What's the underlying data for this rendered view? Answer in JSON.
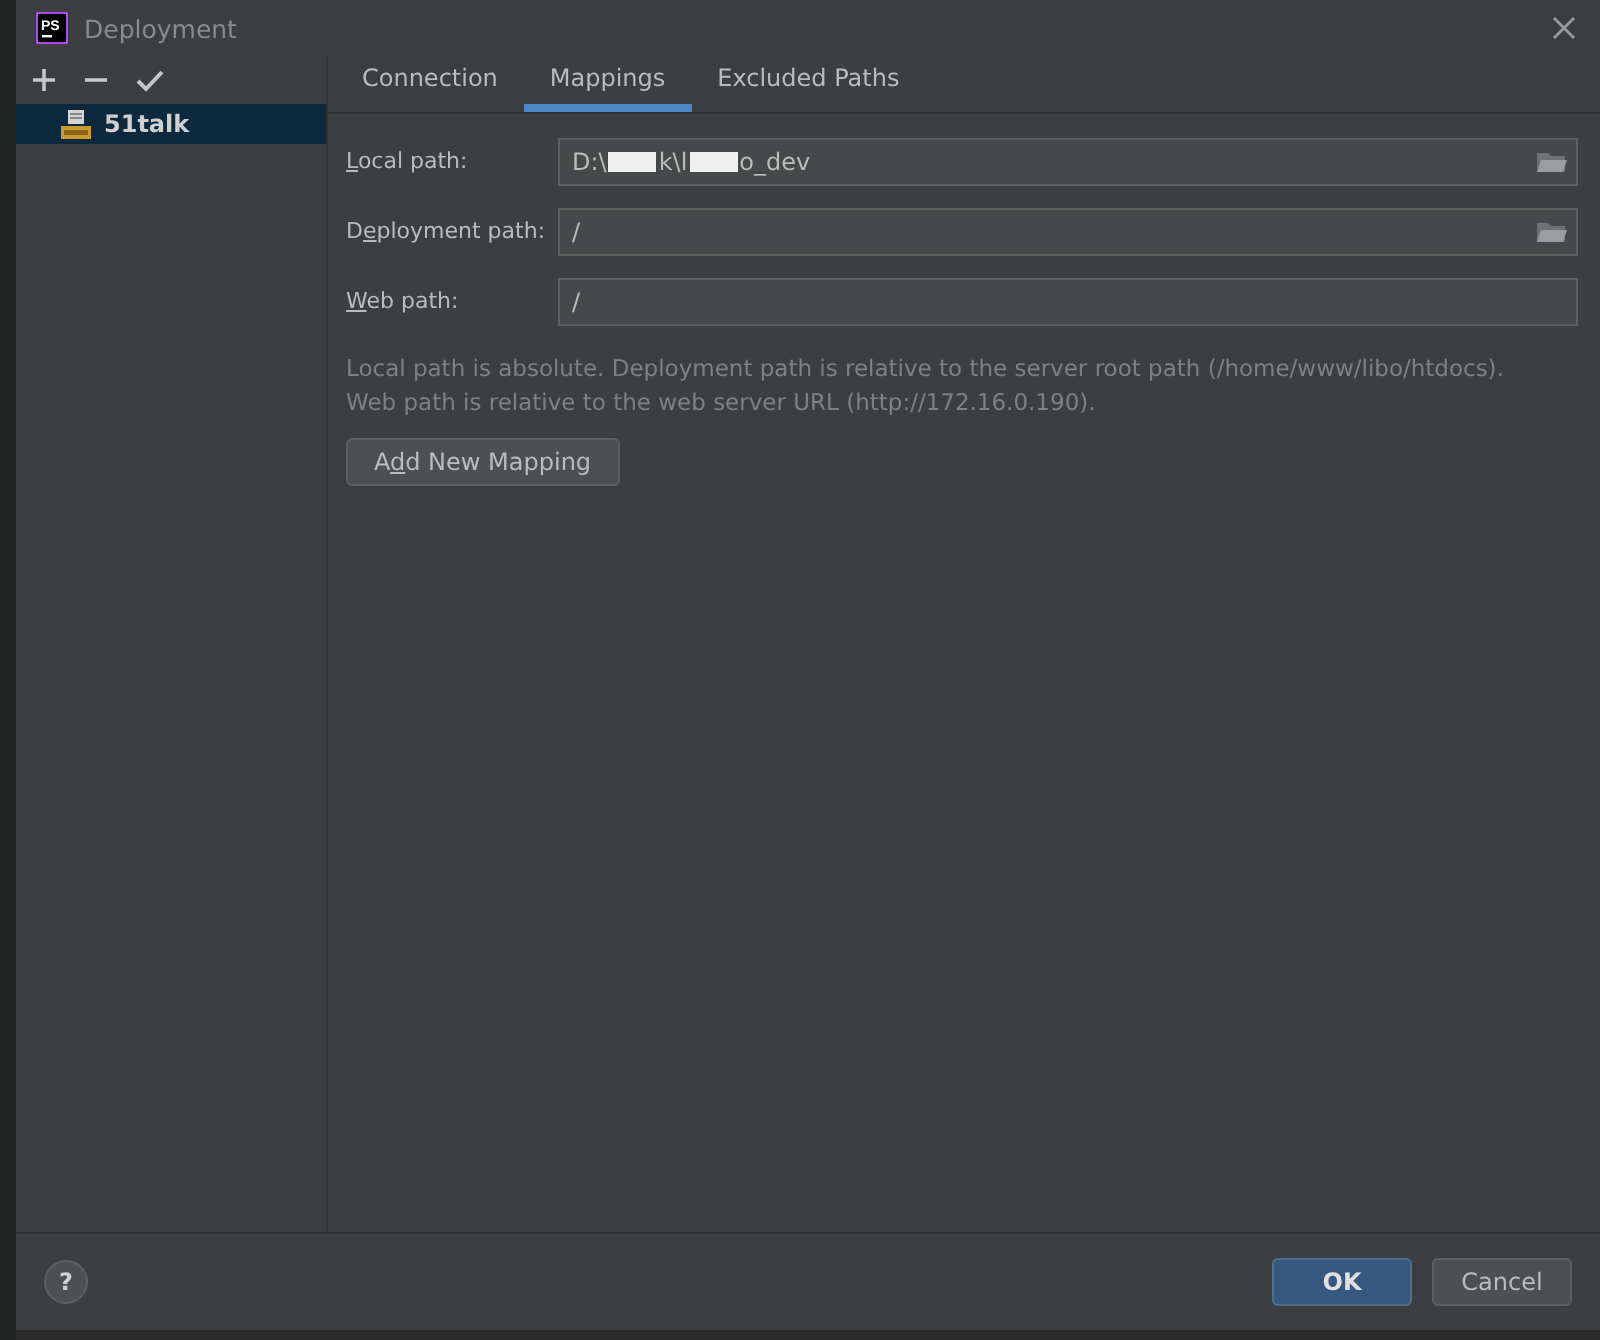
{
  "window": {
    "title": "Deployment",
    "logo_text": "PS"
  },
  "toolbar": {
    "buttons": [
      {
        "kind": "add"
      },
      {
        "kind": "remove"
      },
      {
        "kind": "check"
      }
    ]
  },
  "servers": [
    {
      "name": "51talk",
      "selected": true
    }
  ],
  "tabs": [
    {
      "label": "Connection",
      "selected": false
    },
    {
      "label": "Mappings",
      "selected": true
    },
    {
      "label": "Excluded Paths",
      "selected": false
    }
  ],
  "fields": [
    {
      "label": {
        "mnemonic": "L",
        "after": "ocal path:"
      },
      "value_segments": [
        "D:\\",
        "k\\l",
        "o_dev"
      ],
      "browse": true
    },
    {
      "label": {
        "before": "D",
        "mnemonic": "e",
        "after": "ployment path:"
      },
      "value_segments": [
        "/"
      ],
      "browse": true
    },
    {
      "label": {
        "mnemonic": "W",
        "after": "eb path:"
      },
      "value_segments": [
        "/"
      ],
      "browse": false
    }
  ],
  "hints": [
    "Local path is absolute. Deployment path is relative to the server root path (/home/www/libo/htdocs).",
    "Web path is relative to the web server URL (http://172.16.0.190)."
  ],
  "add_button": {
    "before": "A",
    "mnemonic": "d",
    "after": "d New Mapping"
  },
  "footer": {
    "help": "?",
    "ok": "OK",
    "cancel": "Cancel"
  }
}
